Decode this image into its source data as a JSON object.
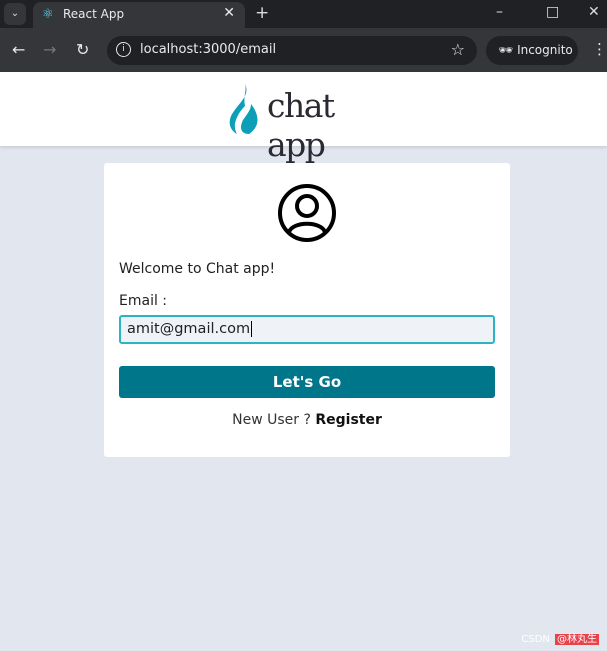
{
  "browser": {
    "tab_title": "React App",
    "url": "localhost:3000/email",
    "incognito_label": "Incognito"
  },
  "header": {
    "logo_text": "chat app",
    "accent": "#0d9fb8"
  },
  "card": {
    "welcome": "Welcome to Chat app!",
    "email_label": "Email :",
    "email_value": "amit@gmail.com",
    "submit_label": "Let's Go",
    "new_user_text": "New User ?",
    "register_label": "Register",
    "button_color": "#00768a"
  },
  "watermark": {
    "prefix": "CSDN",
    "handle": "@林丸生"
  }
}
